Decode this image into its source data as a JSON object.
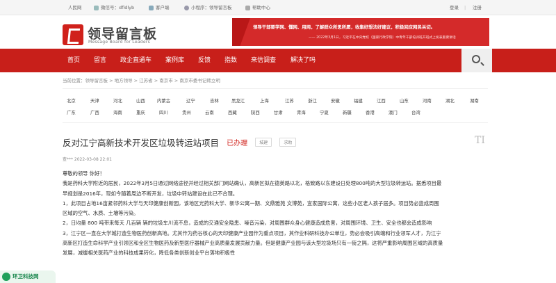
{
  "topbar": {
    "items": [
      "人民网",
      "微信号：dfldlyb",
      "客户端",
      "小程序：领导留言板",
      "帮助中心"
    ],
    "login": "登录",
    "divider": "|",
    "register": "注册"
  },
  "header": {
    "logo_title": "领导留言板",
    "logo_subtitle": "Message Board for Leaders",
    "banner_line1": "领导干部要学网、懂网、用网，了解群众所思所愿，收集好想法好建议，积极回应网民关切。",
    "banner_line2": "—— 2022年3月1日，习近平在中央党校（国家行政学院）中青年干部培训班开班式上发表重要讲话"
  },
  "nav": {
    "items": [
      "首页",
      "留言",
      "政企直通车",
      "案例库",
      "反馈",
      "指数",
      "来信调查",
      "解决了吗"
    ]
  },
  "breadcrumb": {
    "text": "当前位置：领导留言板 > 地方领导 > 江苏省 > 南京市 > 南京市委书记韩立明"
  },
  "regions": {
    "row1": [
      "北京",
      "天津",
      "河北",
      "山西",
      "内蒙古",
      "辽宁",
      "吉林",
      "黑龙江",
      "上海",
      "江苏",
      "浙江",
      "安徽",
      "福建",
      "江西",
      "山东",
      "河南",
      "湖北",
      "湖南"
    ],
    "row2": [
      "广东",
      "广西",
      "海南",
      "重庆",
      "四川",
      "贵州",
      "云南",
      "西藏",
      "陕西",
      "甘肃",
      "青海",
      "宁夏",
      "新疆",
      "香港",
      "澳门",
      "台湾"
    ]
  },
  "message": {
    "title": "反对江宁高新技术开发区垃圾转运站项目",
    "status": "已办理",
    "tags": [
      "城建",
      "求助"
    ],
    "meta": "查***    2022-03-08 22:01",
    "greeting": "尊敬的领导 你好！",
    "lines": [
      "我是药科大学附近的居民，2022年3月5日通过网络途径并经过相关部门网站确认，高新区拟在德英路以北，格致路以东建设日处理800吨的大型垃圾转运站。据悉项目最",
      "早规划是2016年，现如今随着周边不断开发，垃圾中转站建设在此已不合理。",
      "1，此项目占地16亩紧邻药科大学与天印健康创新园，该地区光药科大学、新华公寓一期、文鼎雅苑 文博苑，宜家国际公寓，这些小区老人孩子居多。项目势必造成周围",
      "区域的空气、水质、土壤等污染。",
      "2，日均量 800 吨带来每天 几百辆 辆的垃圾车川流不息，造成的交通安全隐患、噪音污染，对周围群众身心健康造成危害，对周围环境、卫生、安全也都会造成影响",
      "3，江宁区一直在大学城打造生物医药创新高地。尤其作为药谷核心的天印健康产业园作为重点项目，其作业科研科技办公单位，势必会吸引高端和行业领军人才，为江宁",
      "高新区打造生命科学产业引领区和全区生物医药及新型医疗器械产业高质量发展贡献力量。但是健康产业园与该大型垃圾场只有一街之隔，这将严重影响周围区域的高质量",
      "发展，减缓相关医药产业的科技成果转化，降低各类创新创业平台落地积极性"
    ]
  },
  "watermark": {
    "text": "环卫科技网"
  },
  "colors": {
    "brand_red": "#c81f1a",
    "status_red": "#d0211b",
    "watermark_green": "#1ea05a"
  }
}
